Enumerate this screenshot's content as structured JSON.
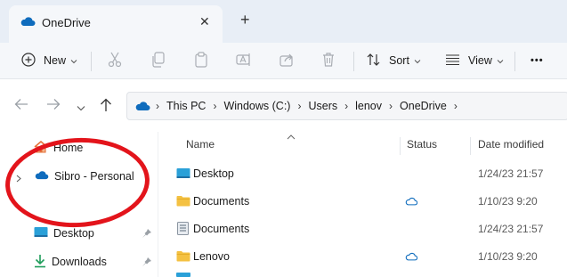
{
  "tab": {
    "title": "OneDrive",
    "close_glyph": "✕",
    "new_glyph": "+"
  },
  "toolbar": {
    "new_label": "New",
    "sort_label": "Sort",
    "view_label": "View",
    "more_glyph": "•••"
  },
  "address": {
    "crumbs": [
      "This PC",
      "Windows (C:)",
      "Users",
      "lenov",
      "OneDrive"
    ]
  },
  "nav": {
    "items": [
      {
        "label": "Home"
      },
      {
        "label": "Sibro - Personal"
      },
      {
        "label": "Desktop"
      },
      {
        "label": "Downloads"
      }
    ]
  },
  "columns": {
    "name": "Name",
    "status": "Status",
    "date": "Date modified"
  },
  "files": [
    {
      "name": "Desktop",
      "icon": "desktop-folder-icon",
      "status": "",
      "date": "1/24/23 21:57"
    },
    {
      "name": "Documents",
      "icon": "folder-icon",
      "status": "cloud",
      "date": "1/10/23 9:20"
    },
    {
      "name": "Documents",
      "icon": "document-file-icon",
      "status": "",
      "date": "1/24/23 21:57"
    },
    {
      "name": "Lenovo",
      "icon": "folder-icon",
      "status": "cloud",
      "date": "1/10/23 9:20"
    }
  ],
  "colors": {
    "accent": "#0f6cbd",
    "folder": "#f4c142",
    "annotation": "#e3141b"
  }
}
